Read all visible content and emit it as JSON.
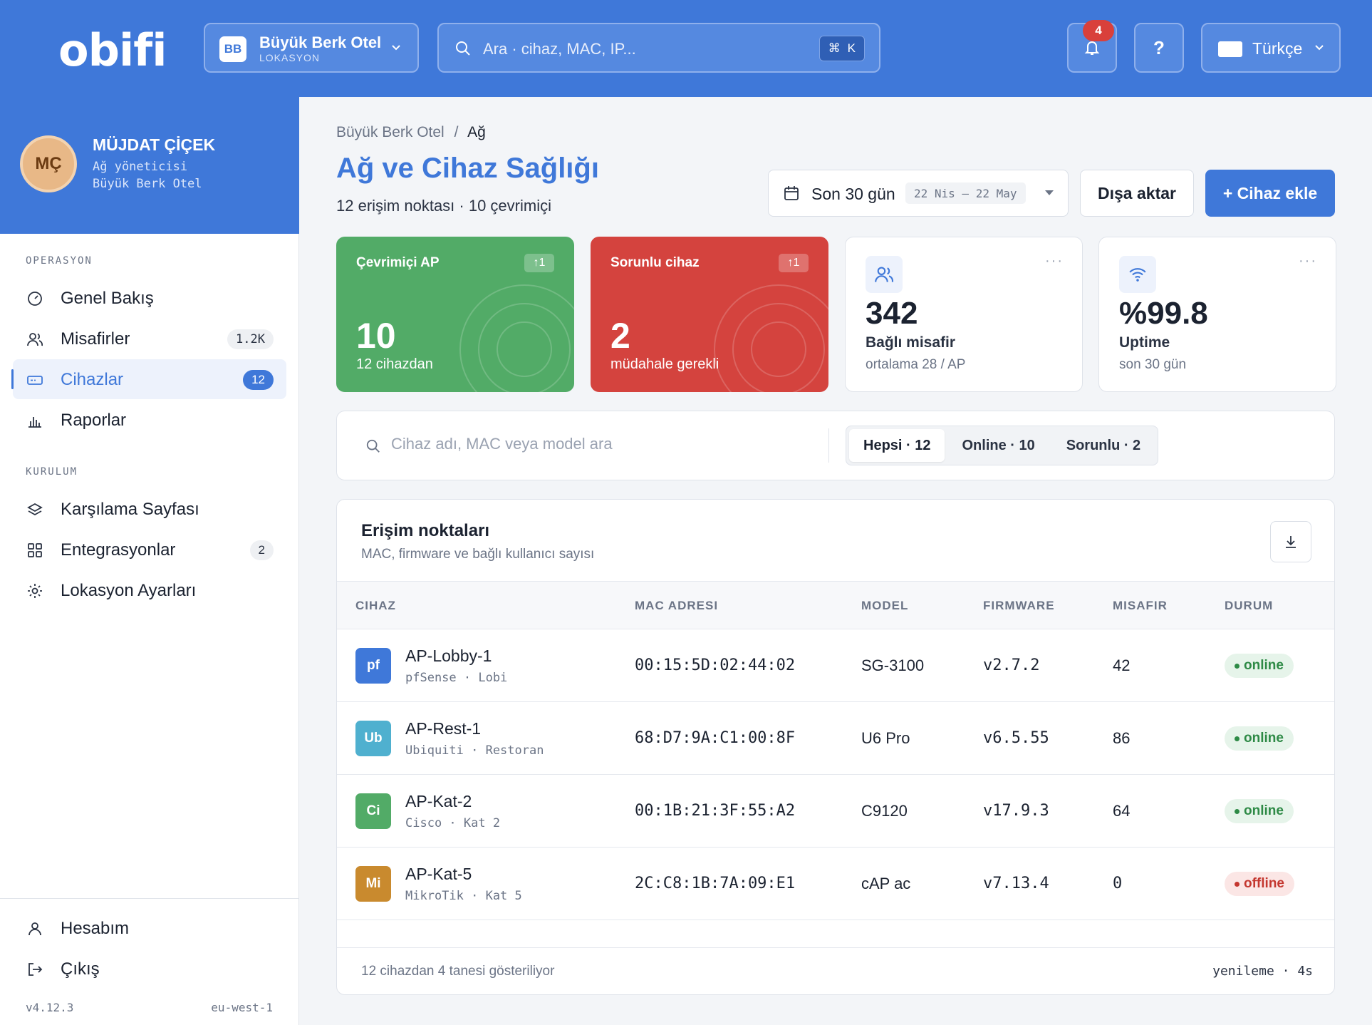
{
  "brand": {
    "logo": "obifi",
    "accent": "#3f78d9"
  },
  "location": {
    "badge": "BB",
    "name": "Büyük Berk Otel",
    "type": "LOKASYON"
  },
  "search": {
    "placeholder": "Ara · cihaz, MAC, IP...",
    "shortcut_mod": "⌘",
    "shortcut_key": "K"
  },
  "notifications": {
    "count": "4",
    "icon": "bell-icon"
  },
  "help": {
    "label": "?"
  },
  "language": {
    "label": "Türkçe"
  },
  "user": {
    "initials": "MÇ",
    "name": "MÜJDAT ÇİÇEK",
    "role": "Ağ yöneticisi",
    "location": "Büyük Berk Otel"
  },
  "sidebar": {
    "section_ops": "OPERASYON",
    "section_setup": "KURULUM",
    "ops_items": [
      {
        "label": "Genel Bakış",
        "icon": "dashboard-icon"
      },
      {
        "label": "Misafirler",
        "badge": "1.2K",
        "icon": "users-icon"
      },
      {
        "label": "Cihazlar",
        "badge": "12",
        "icon": "device-icon",
        "active": true
      },
      {
        "label": "Raporlar",
        "icon": "chart-icon"
      }
    ],
    "setup_items": [
      {
        "label": "Karşılama Sayfası",
        "icon": "layers-icon"
      },
      {
        "label": "Entegrasyonlar",
        "badge": "2",
        "icon": "grid-icon"
      },
      {
        "label": "Lokasyon Ayarları",
        "icon": "settings-icon"
      }
    ],
    "account": "Hesabım",
    "logout": "Çıkış",
    "version": "v4.12.3",
    "region": "eu-west-1"
  },
  "breadcrumb": {
    "parent": "Büyük Berk Otel",
    "sep": "/",
    "current": "Ağ"
  },
  "page": {
    "title": "Ağ ve Cihaz Sağlığı",
    "subtitle": "12 erişim noktası · 10 çevrimiçi"
  },
  "toolbar": {
    "date_label": "Son 30 gün",
    "date_range": "22 Nis — 22 May",
    "export": "Dışa aktar",
    "add": "+ Cihaz ekle"
  },
  "stats": {
    "online_ap": {
      "title": "Çevrimiçi AP",
      "trend": "↑1",
      "value": "10",
      "sub": "12 cihazdan",
      "color": "#52ab67"
    },
    "problem": {
      "title": "Sorunlu cihaz",
      "trend": "↑1",
      "value": "2",
      "sub": "müdahale gerekli",
      "color": "#d4433e"
    },
    "guests": {
      "value": "342",
      "label": "Bağlı misafir",
      "sub": "ortalama 28 / AP",
      "more": "···"
    },
    "uptime": {
      "value": "%99.8",
      "label": "Uptime",
      "sub": "son 30 gün",
      "more": "···"
    }
  },
  "filter": {
    "placeholder": "Cihaz adı, MAC veya model ara",
    "tabs": [
      "Hepsi · 12",
      "Online · 10",
      "Sorunlu · 2"
    ],
    "active": 0
  },
  "table": {
    "title": "Erişim noktaları",
    "subtitle": "MAC, firmware ve bağlı kullanıcı sayısı",
    "columns": [
      "CIHAZ",
      "MAC ADRESI",
      "MODEL",
      "FIRMWARE",
      "MISAFIR",
      "DURUM"
    ],
    "rows": [
      {
        "abbr": "pf",
        "color": "#3f78d9",
        "name": "AP-Lobby-1",
        "meta": "pfSense · Lobi",
        "mac": "00:15:5D:02:44:02",
        "model": "SG-3100",
        "firmware": "v2.7.2",
        "guests": "42",
        "status": "online"
      },
      {
        "abbr": "Ub",
        "color": "#4fb0cf",
        "name": "AP-Rest-1",
        "meta": "Ubiquiti · Restoran",
        "mac": "68:D7:9A:C1:00:8F",
        "model": "U6 Pro",
        "firmware": "v6.5.55",
        "guests": "86",
        "status": "online"
      },
      {
        "abbr": "Ci",
        "color": "#52ab67",
        "name": "AP-Kat-2",
        "meta": "Cisco · Kat 2",
        "mac": "00:1B:21:3F:55:A2",
        "model": "C9120",
        "firmware": "v17.9.3",
        "guests": "64",
        "status": "online"
      },
      {
        "abbr": "Mi",
        "color": "#c98a2e",
        "name": "AP-Kat-5",
        "meta": "MikroTik · Kat 5",
        "mac": "2C:C8:1B:7A:09:E1",
        "model": "cAP ac",
        "firmware": "v7.13.4",
        "guests": "0",
        "status": "offline"
      }
    ],
    "footer_left": "12 cihazdan 4 tanesi gösteriliyor",
    "footer_right": "yenileme · 4s"
  }
}
